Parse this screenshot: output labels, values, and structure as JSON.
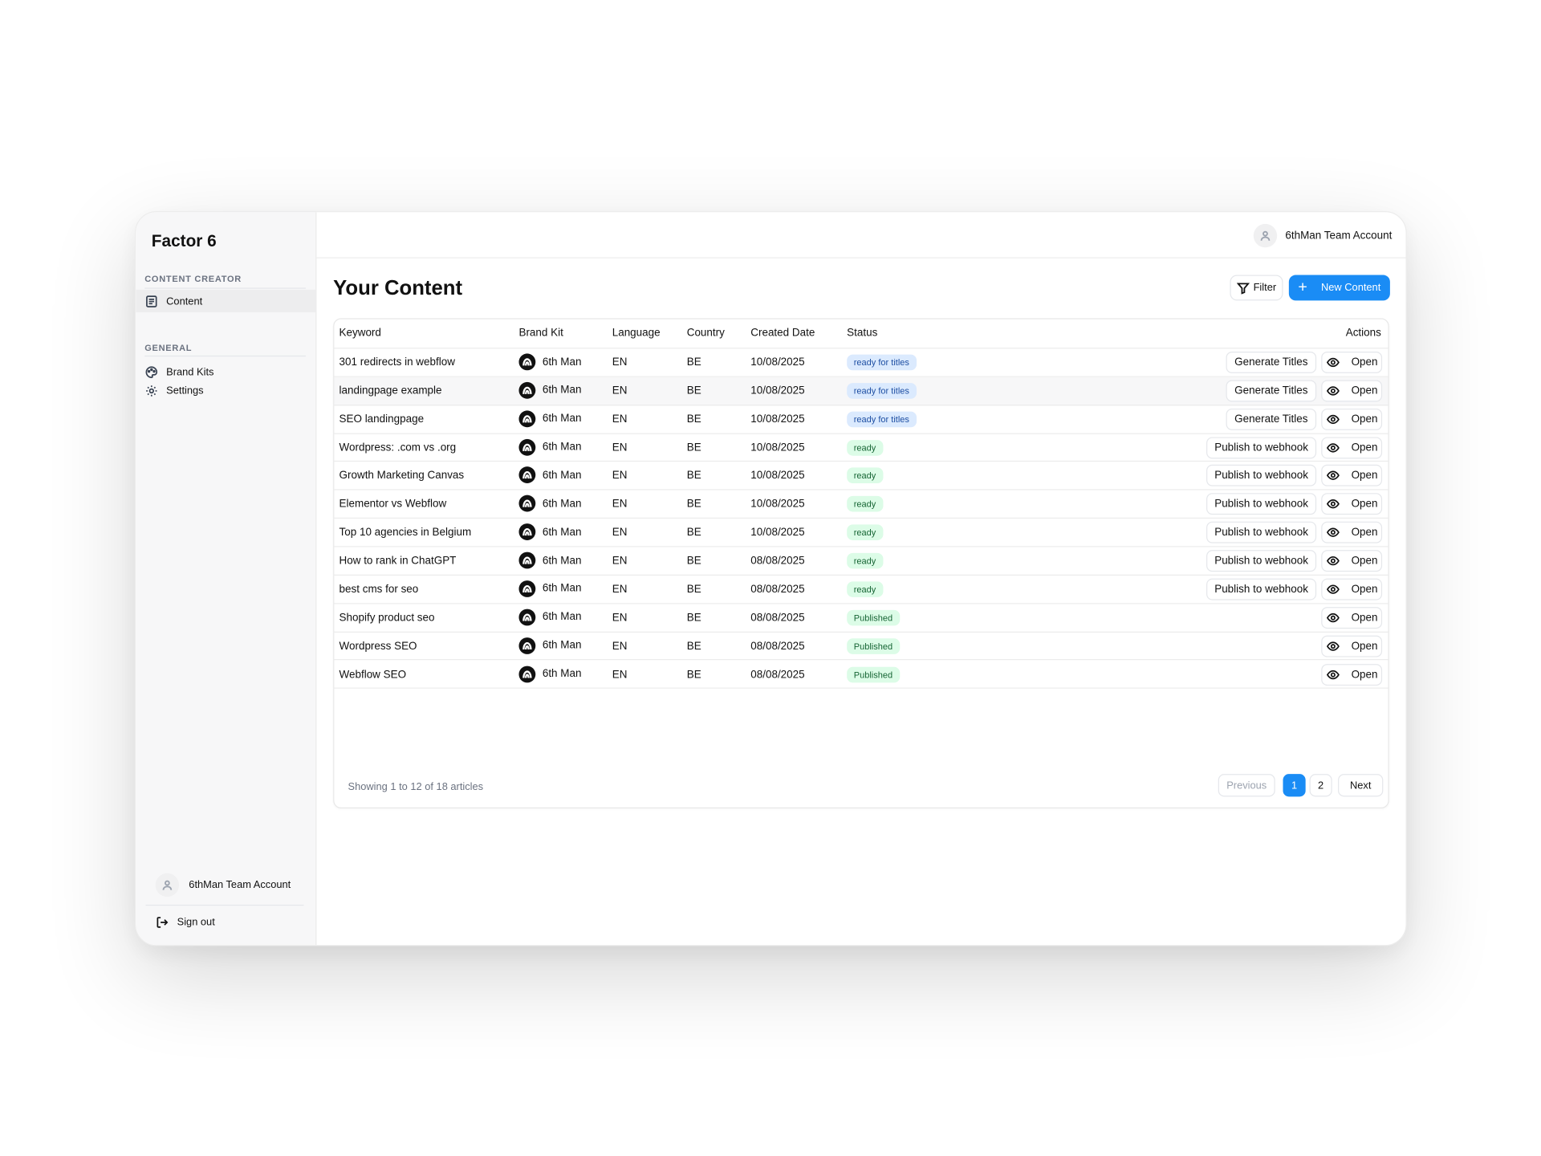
{
  "app": {
    "name": "Factor 6"
  },
  "sidebar": {
    "sections": [
      {
        "label": "CONTENT CREATOR",
        "items": [
          {
            "label": "Content",
            "icon": "document-icon",
            "active": true
          }
        ]
      },
      {
        "label": "GENERAL",
        "items": [
          {
            "label": "Brand Kits",
            "icon": "palette-icon"
          },
          {
            "label": "Settings",
            "icon": "gear-icon"
          }
        ]
      }
    ],
    "account": "6thMan Team Account",
    "signout": "Sign out"
  },
  "topbar": {
    "account": "6thMan Team Account"
  },
  "page": {
    "title": "Your Content",
    "filter_label": "Filter",
    "new_label": "New Content"
  },
  "table": {
    "headers": [
      "Keyword",
      "Brand Kit",
      "Language",
      "Country",
      "Created Date",
      "Status",
      "Actions"
    ],
    "rows": [
      {
        "keyword": "301 redirects in webflow",
        "brand": "6th Man",
        "lang": "EN",
        "country": "BE",
        "date": "10/08/2025",
        "status": "ready for titles",
        "status_color": "blue",
        "action": "Generate Titles",
        "open": "Open"
      },
      {
        "keyword": "landingpage example",
        "brand": "6th Man",
        "lang": "EN",
        "country": "BE",
        "date": "10/08/2025",
        "status": "ready for titles",
        "status_color": "blue",
        "action": "Generate Titles",
        "open": "Open"
      },
      {
        "keyword": "SEO landingpage",
        "brand": "6th Man",
        "lang": "EN",
        "country": "BE",
        "date": "10/08/2025",
        "status": "ready for titles",
        "status_color": "blue",
        "action": "Generate Titles",
        "open": "Open"
      },
      {
        "keyword": "Wordpress: .com vs .org",
        "brand": "6th Man",
        "lang": "EN",
        "country": "BE",
        "date": "10/08/2025",
        "status": "ready",
        "status_color": "green",
        "action": "Publish to webhook",
        "open": "Open"
      },
      {
        "keyword": "Growth Marketing Canvas",
        "brand": "6th Man",
        "lang": "EN",
        "country": "BE",
        "date": "10/08/2025",
        "status": "ready",
        "status_color": "green",
        "action": "Publish to webhook",
        "open": "Open"
      },
      {
        "keyword": "Elementor vs Webflow",
        "brand": "6th Man",
        "lang": "EN",
        "country": "BE",
        "date": "10/08/2025",
        "status": "ready",
        "status_color": "green",
        "action": "Publish to webhook",
        "open": "Open"
      },
      {
        "keyword": "Top 10 agencies in Belgium",
        "brand": "6th Man",
        "lang": "EN",
        "country": "BE",
        "date": "10/08/2025",
        "status": "ready",
        "status_color": "green",
        "action": "Publish to webhook",
        "open": "Open"
      },
      {
        "keyword": "How to rank in ChatGPT",
        "brand": "6th Man",
        "lang": "EN",
        "country": "BE",
        "date": "08/08/2025",
        "status": "ready",
        "status_color": "green",
        "action": "Publish to webhook",
        "open": "Open"
      },
      {
        "keyword": "best cms for seo",
        "brand": "6th Man",
        "lang": "EN",
        "country": "BE",
        "date": "08/08/2025",
        "status": "ready",
        "status_color": "green",
        "action": "Publish to webhook",
        "open": "Open"
      },
      {
        "keyword": "Shopify product seo",
        "brand": "6th Man",
        "lang": "EN",
        "country": "BE",
        "date": "08/08/2025",
        "status": "Published",
        "status_color": "green",
        "action": "",
        "open": "Open"
      },
      {
        "keyword": "Wordpress SEO",
        "brand": "6th Man",
        "lang": "EN",
        "country": "BE",
        "date": "08/08/2025",
        "status": "Published",
        "status_color": "green",
        "action": "",
        "open": "Open"
      },
      {
        "keyword": "Webflow SEO",
        "brand": "6th Man",
        "lang": "EN",
        "country": "BE",
        "date": "08/08/2025",
        "status": "Published",
        "status_color": "green",
        "action": "",
        "open": "Open"
      }
    ],
    "footer": "Showing 1 to 12 of 18 articles",
    "pagination": {
      "previous": "Previous",
      "pages": [
        "1",
        "2"
      ],
      "current": "1",
      "next": "Next"
    }
  },
  "colors": {
    "accent": "#1a8cf5",
    "badge_blue_bg": "#dbeafe",
    "badge_green_bg": "#dcfce7"
  }
}
